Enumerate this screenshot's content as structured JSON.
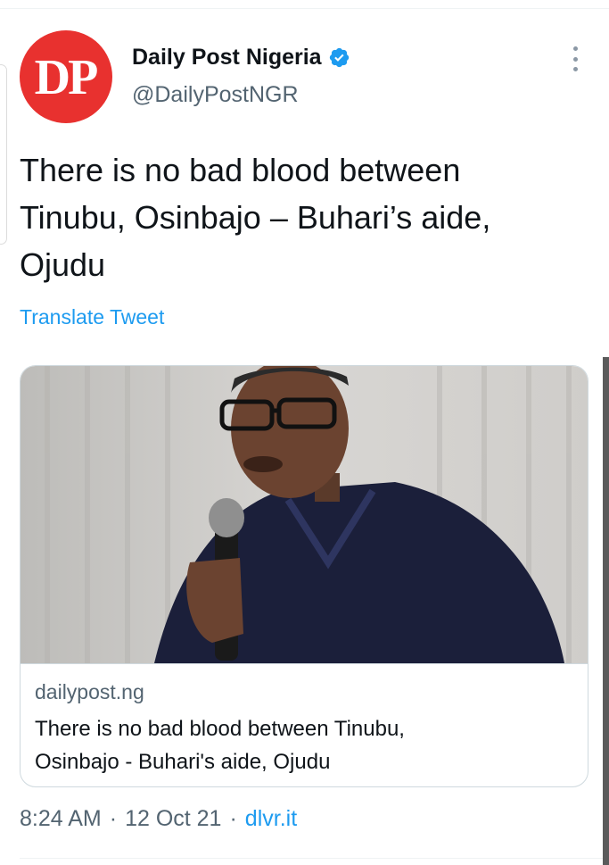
{
  "tweet": {
    "author": {
      "avatar_text": "DP",
      "display_name": "Daily Post Nigeria",
      "handle": "@DailyPostNGR",
      "verified_icon": "verified-badge-icon"
    },
    "more_icon": "more-vertical-icon",
    "text_lines": [
      "There is no bad blood between",
      "Tinubu, Osinbajo – Buhari’s aide,",
      "Ojudu"
    ],
    "translate_label": "Translate Tweet",
    "card": {
      "image_icon": "article-photo",
      "domain": "dailypost.ng",
      "title_lines": [
        "There is no bad blood between Tinubu,",
        "Osinbajo - Buhari's aide, Ojudu"
      ]
    },
    "meta": {
      "time": "8:24 AM",
      "separator": "·",
      "date": "12 Oct 21",
      "source": "dlvr.it"
    }
  },
  "colors": {
    "brand_red": "#e8312f",
    "link_blue": "#1d9bf0",
    "secondary_text": "#536471",
    "primary_text": "#0f1419",
    "border": "#cfd9de"
  }
}
